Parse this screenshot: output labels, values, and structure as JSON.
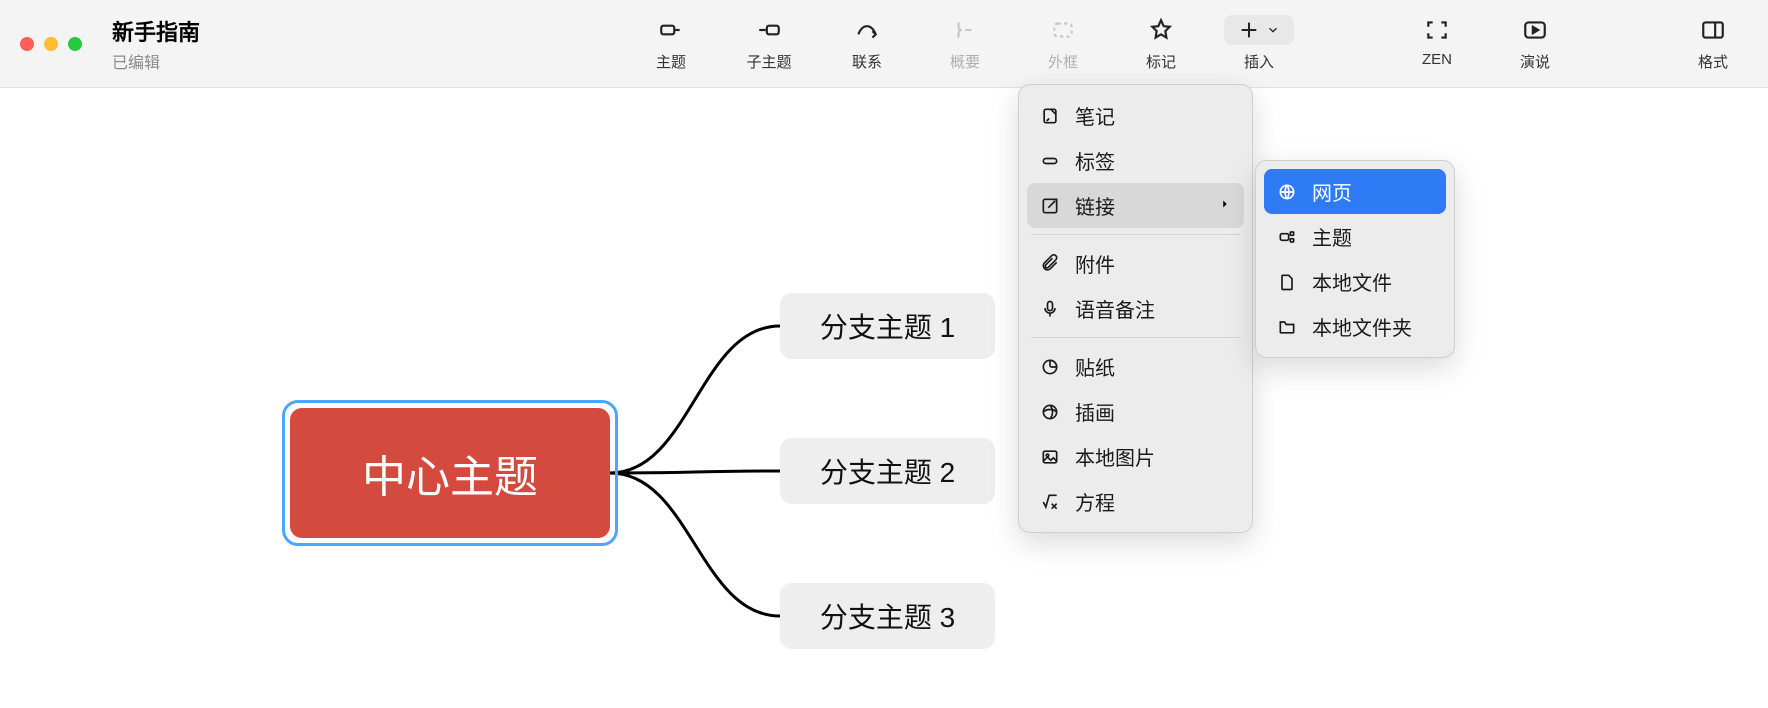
{
  "window": {
    "title": "新手指南",
    "subtitle": "已编辑"
  },
  "toolbar": {
    "topic": "主题",
    "subtopic": "子主题",
    "relation": "联系",
    "summary": "概要",
    "boundary": "外框",
    "marker": "标记",
    "insert": "插入",
    "zen": "ZEN",
    "present": "演说",
    "format": "格式"
  },
  "mindmap": {
    "central": "中心主题",
    "branches": [
      "分支主题 1",
      "分支主题 2",
      "分支主题 3"
    ]
  },
  "insert_menu": {
    "note": "笔记",
    "label": "标签",
    "link": "链接",
    "attachment": "附件",
    "audio": "语音备注",
    "sticker": "贴纸",
    "illustration": "插画",
    "local_image": "本地图片",
    "equation": "方程"
  },
  "link_submenu": {
    "web": "网页",
    "topic": "主题",
    "local_file": "本地文件",
    "local_folder": "本地文件夹"
  }
}
